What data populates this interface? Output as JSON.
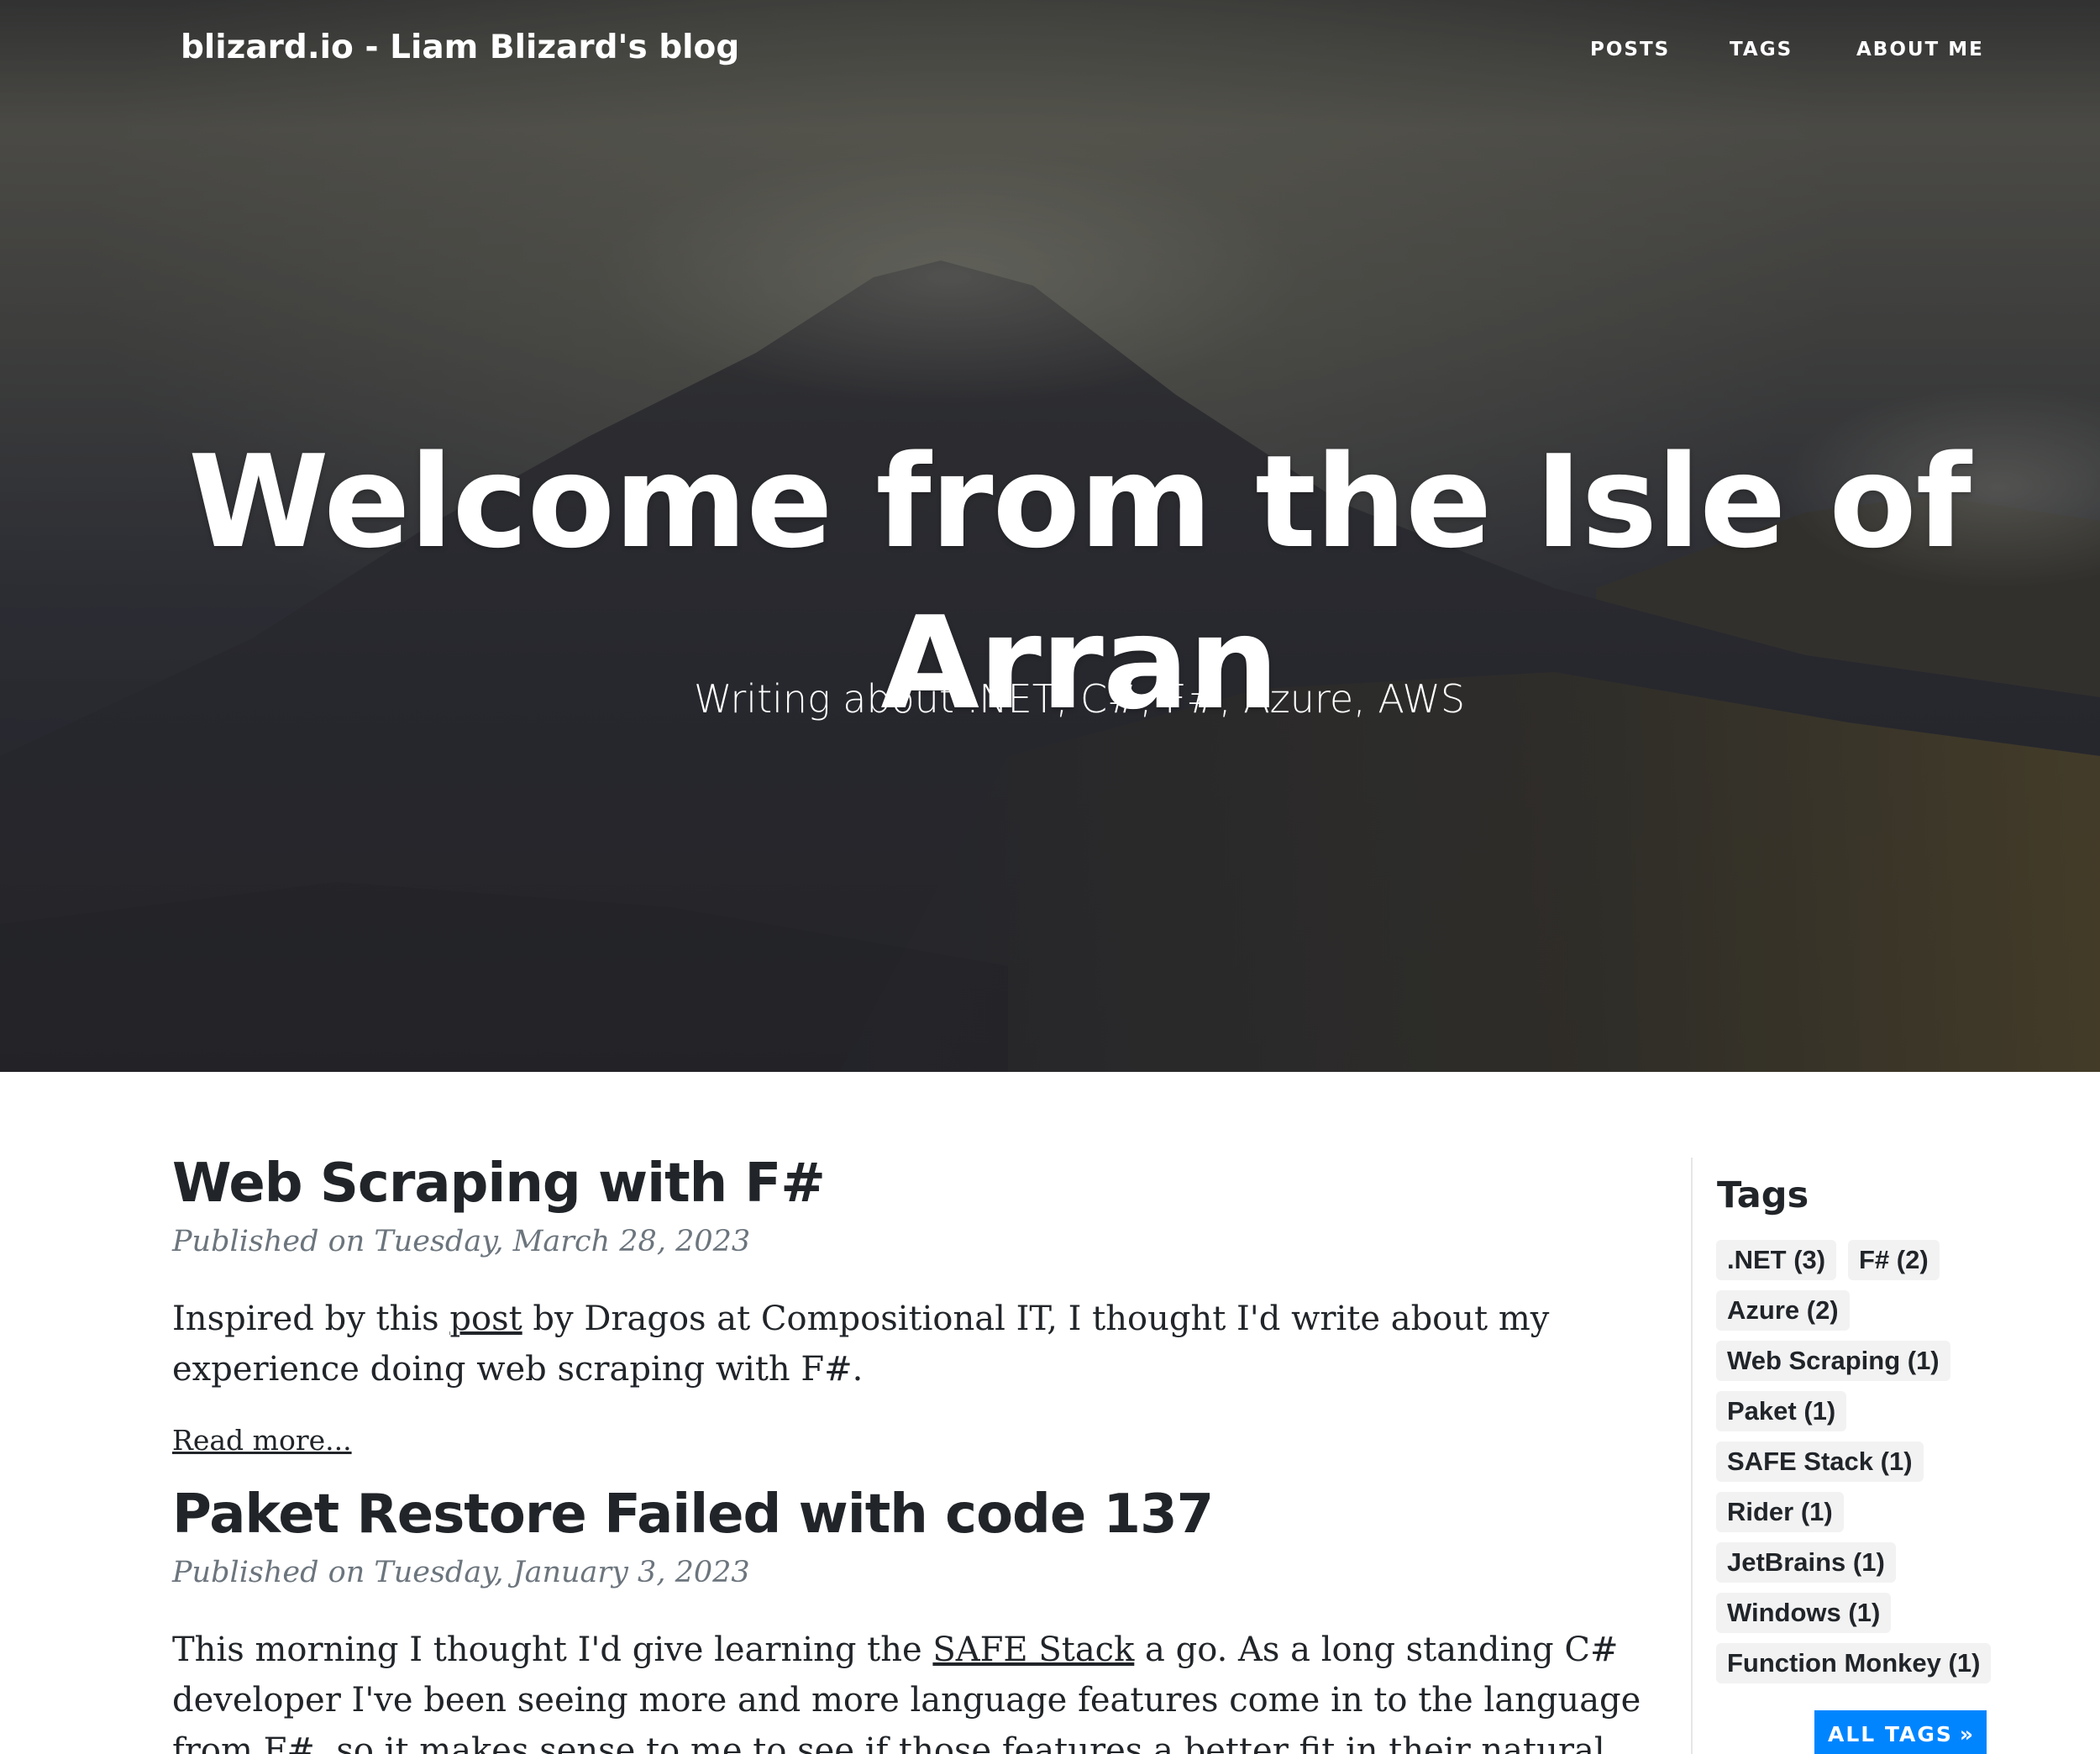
{
  "navbar": {
    "brand": "blizard.io - Liam Blizard's blog",
    "links": [
      "POSTS",
      "TAGS",
      "ABOUT ME"
    ]
  },
  "hero": {
    "heading_line1": "Welcome from the Isle of",
    "heading_line2": "Arran",
    "subheading": "Writing about .NET, C#, F#, Azure, AWS"
  },
  "posts": [
    {
      "title": "Web Scraping with F#",
      "meta": "Published on Tuesday, March 28, 2023",
      "excerpt_before": "Inspired by this ",
      "excerpt_link": "post",
      "excerpt_after": " by Dragos at Compositional IT, I thought I'd write about my experience doing web scraping with F#.",
      "read_more": "Read more..."
    },
    {
      "title": "Paket Restore Failed with code 137",
      "meta": "Published on Tuesday, January 3, 2023",
      "excerpt_before": "This morning I thought I'd give learning the ",
      "excerpt_link": "SAFE Stack",
      "excerpt_after": " a go. As a long standing C# developer I've been seeing more and more language features come in to the language from F#, so it makes sense to me to see if those features a better fit in their natural environment."
    }
  ],
  "sidebar": {
    "heading": "Tags",
    "tags": [
      ".NET (3)",
      "F# (2)",
      "Azure (2)",
      "Web Scraping (1)",
      "Paket (1)",
      "SAFE Stack (1)",
      "Rider (1)",
      "JetBrains (1)",
      "Windows (1)",
      "Function Monkey (1)"
    ],
    "all_tags_label": "ALL TAGS",
    "all_tags_icon": "»"
  },
  "colors": {
    "accent": "#0085ff",
    "text": "#212529",
    "muted": "#6c757d",
    "tag_bg": "#f2f2f2"
  },
  "icons": {
    "all_tags": "double-chevron-right-icon"
  }
}
